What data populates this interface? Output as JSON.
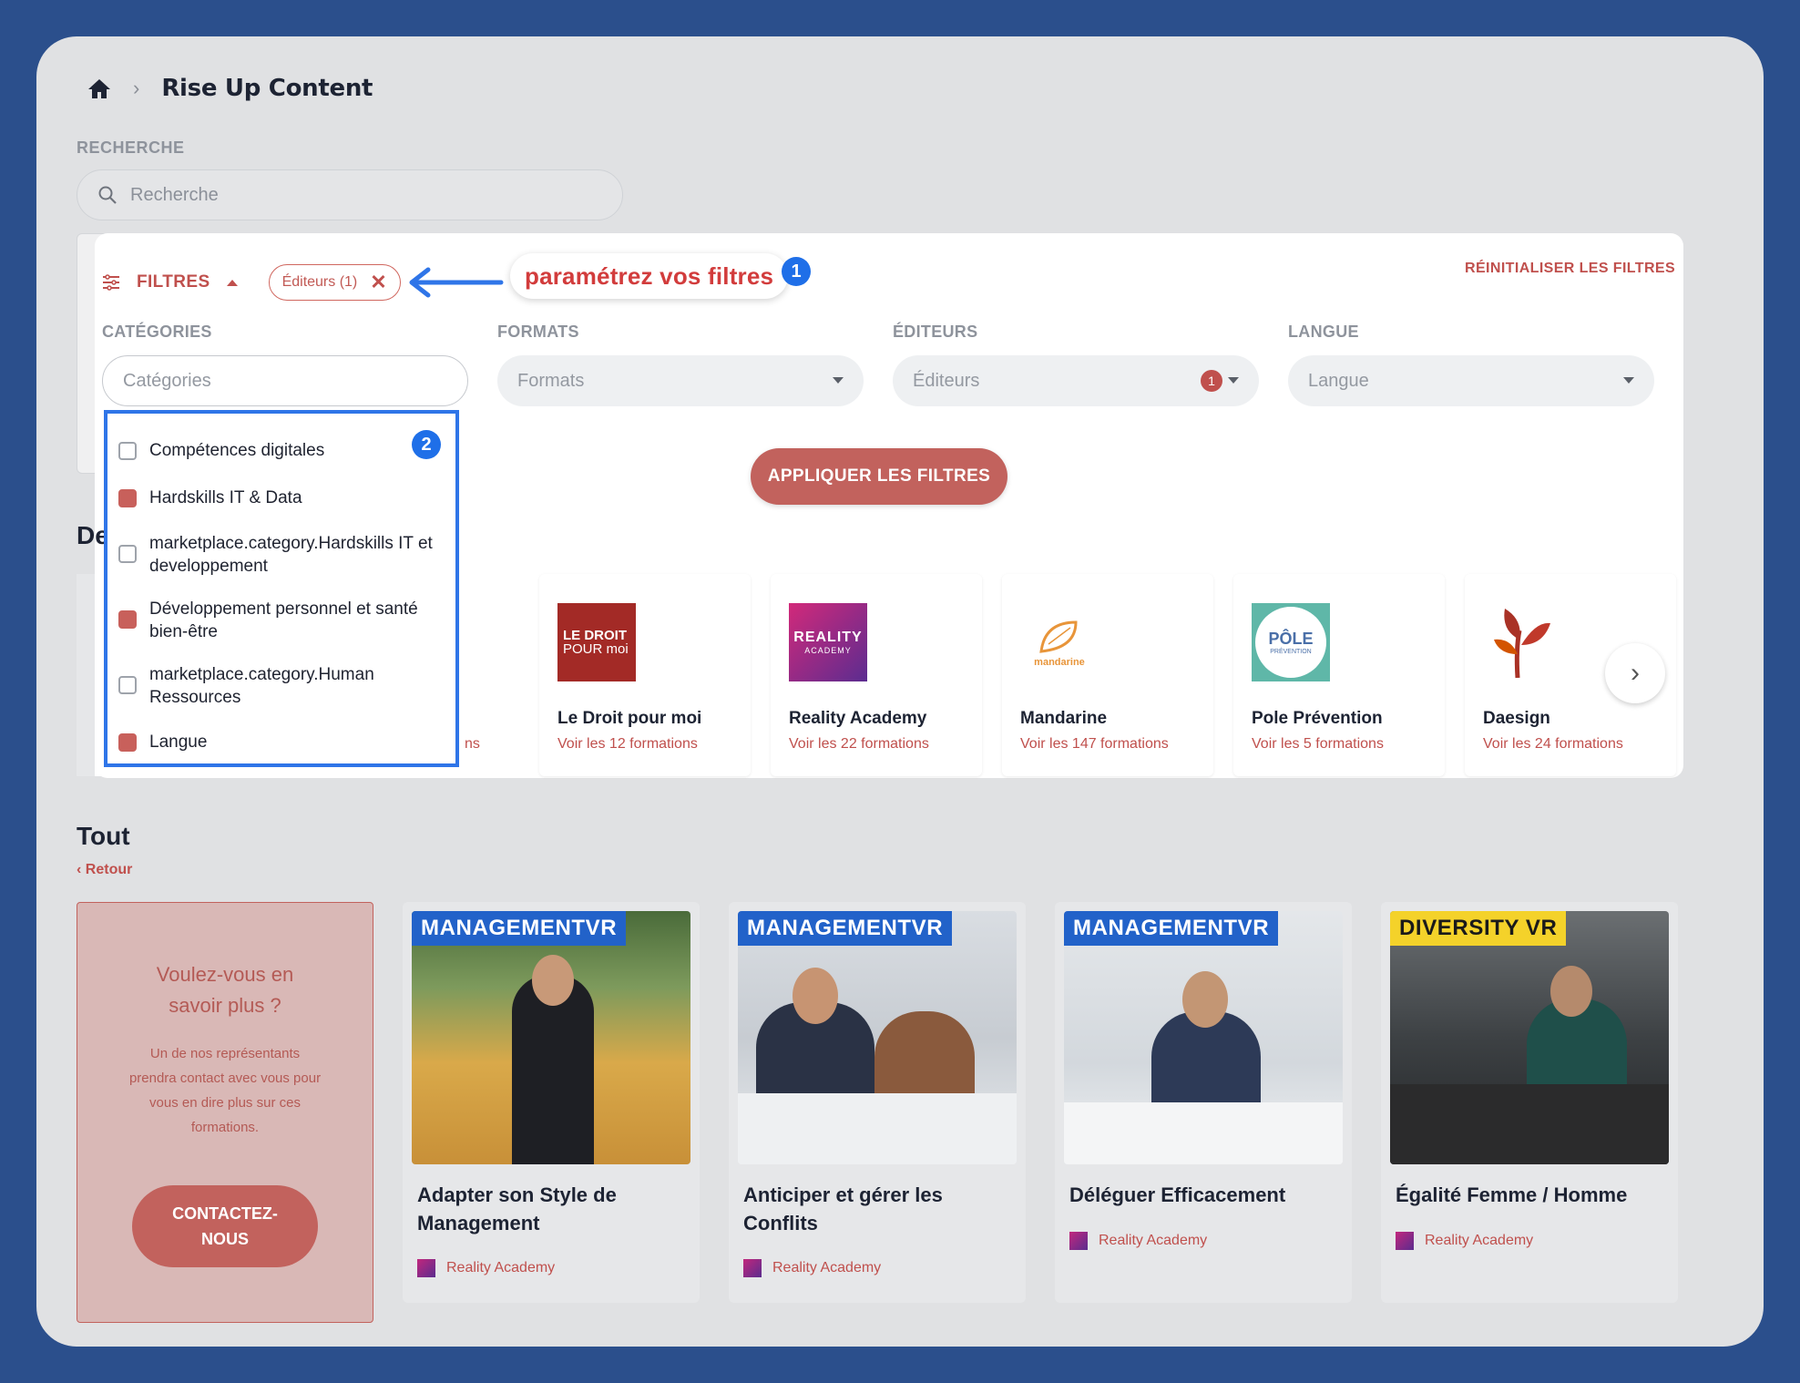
{
  "breadcrumb": {
    "title": "Rise Up Content"
  },
  "search": {
    "label": "RECHERCHE",
    "placeholder": "Recherche"
  },
  "filters": {
    "toggle_label": "FILTRES",
    "chip_label": "Éditeurs (1)",
    "annotation": "paramétrez vos filtres",
    "badge_1": "1",
    "badge_2": "2",
    "reset_label": "RÉINITIALISER LES FILTRES",
    "apply_label": "APPLIQUER LES FILTRES",
    "fields": [
      {
        "label": "CATÉGORIES",
        "placeholder": "Catégories"
      },
      {
        "label": "FORMATS",
        "placeholder": "Formats"
      },
      {
        "label": "ÉDITEURS",
        "placeholder": "Éditeurs",
        "count": "1"
      },
      {
        "label": "LANGUE",
        "placeholder": "Langue"
      }
    ],
    "categories": [
      {
        "label": "Compétences digitales",
        "checked": false
      },
      {
        "label": "Hardskills IT & Data",
        "checked": true
      },
      {
        "label": "marketplace.category.Hardskills IT et developpement",
        "checked": false
      },
      {
        "label": "Développement personnel et santé bien-être",
        "checked": true
      },
      {
        "label": "marketplace.category.Human Ressources",
        "checked": false
      },
      {
        "label": "Langue",
        "checked": true
      }
    ]
  },
  "publishers_section": {
    "title_fragment": "De",
    "partial_sub": "ns"
  },
  "publishers": [
    {
      "name": "Le Droit pour moi",
      "sub": "Voir les 12 formations",
      "logo_icon": "le-droit-pour-moi-logo"
    },
    {
      "name": "Reality Academy",
      "sub": "Voir les 22 formations",
      "logo_icon": "reality-academy-logo"
    },
    {
      "name": "Mandarine",
      "sub": "Voir les 147 formations",
      "logo_icon": "mandarine-logo"
    },
    {
      "name": "Pole Prévention",
      "sub": "Voir les 5 formations",
      "logo_icon": "pole-prevention-logo"
    },
    {
      "name": "Daesign",
      "sub": "Voir les 24 formations",
      "logo_icon": "daesign-logo"
    }
  ],
  "tout": {
    "title": "Tout",
    "back_label": "Retour"
  },
  "contact": {
    "title": "Voulez-vous en savoir plus ?",
    "text": "Un de nos représentants prendra contact avec vous pour vous en dire plus sur ces formations.",
    "button": "CONTACTEZ-NOUS"
  },
  "courses": [
    {
      "title": "Adapter son Style de Management",
      "publisher": "Reality Academy",
      "banner": "MANAGEMENTVR"
    },
    {
      "title": "Anticiper et gérer les Conflits",
      "publisher": "Reality Academy",
      "banner": "MANAGEMENTVR"
    },
    {
      "title": "Déléguer Efficacement",
      "publisher": "Reality Academy",
      "banner": "MANAGEMENTVR"
    },
    {
      "title": "Égalité Femme / Homme",
      "publisher": "Reality Academy",
      "banner": "DIVERSITY VR"
    }
  ],
  "logo_text": {
    "le_droit_1": "LE DROIT",
    "le_droit_2": "POUR moi",
    "reality_1": "REALITY",
    "reality_2": "ACADEMY",
    "mandarine": "mandarine",
    "pole_1": "PÔLE",
    "pole_2": "PRÉVENTION"
  },
  "colors": {
    "accent": "#c0504d",
    "annotation_blue": "#1f6fe8",
    "background": "#2b4f8c"
  }
}
